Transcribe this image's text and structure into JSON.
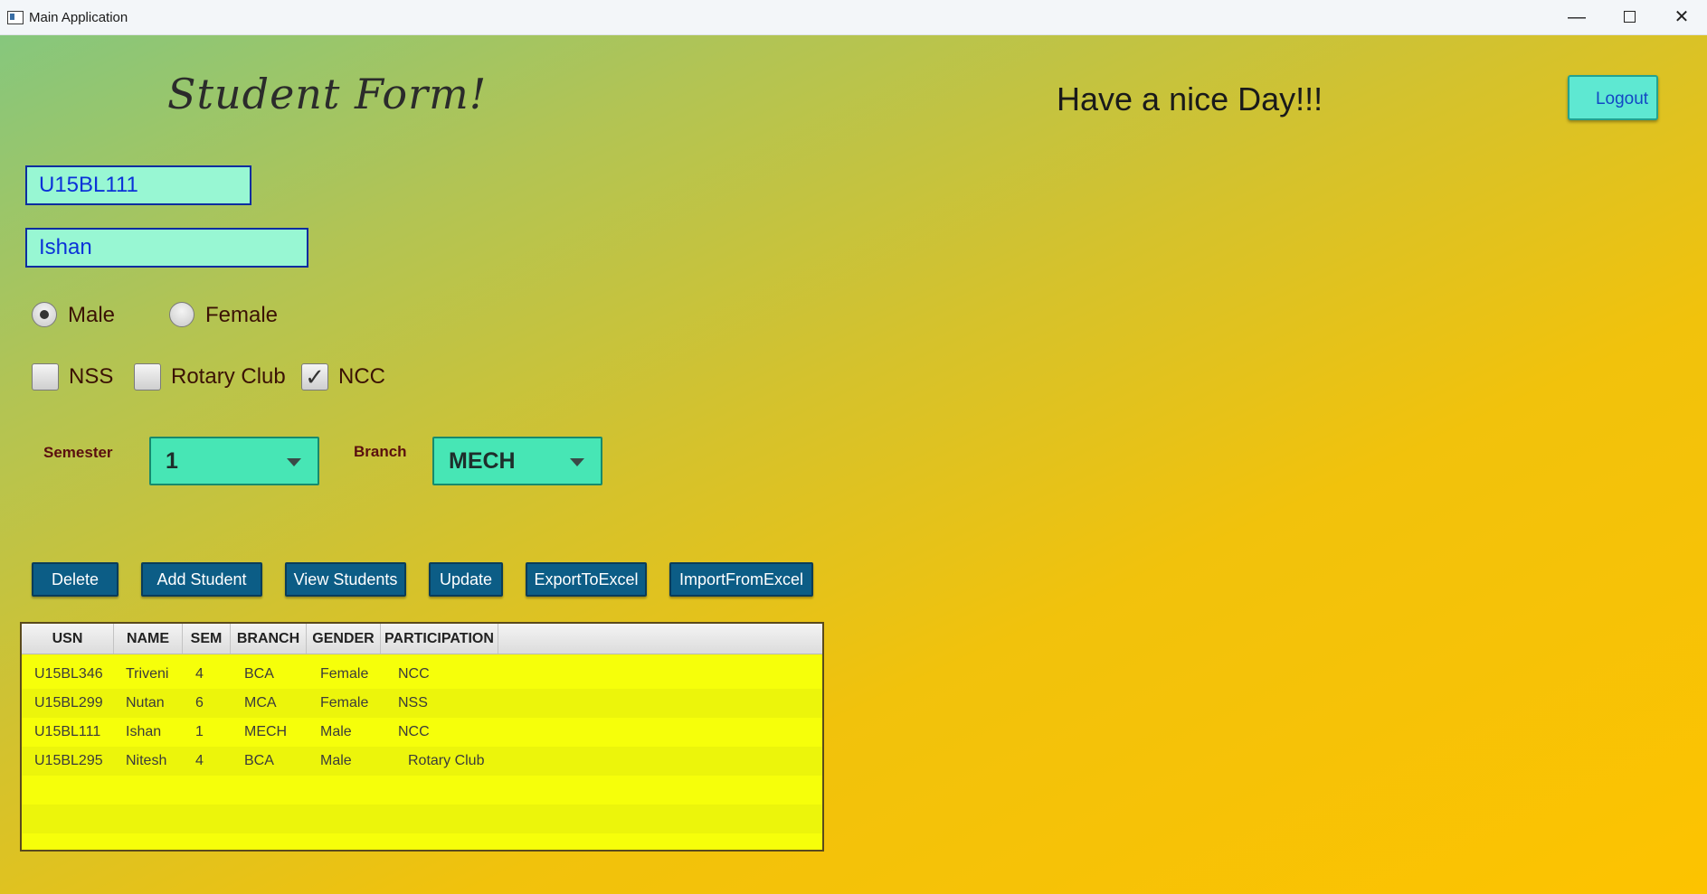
{
  "window": {
    "title": "Main Application",
    "minimize_glyph": "—",
    "close_glyph": "✕"
  },
  "header": {
    "heading": "Student Form!",
    "greeting": "Have a nice Day!!!",
    "logout_label": "Logout"
  },
  "form": {
    "usn_value": "U15BL111",
    "name_value": "Ishan",
    "gender": {
      "options": [
        "Male",
        "Female"
      ],
      "selected": "Male"
    },
    "participation": {
      "options": [
        {
          "label": "NSS",
          "checked": false
        },
        {
          "label": "Rotary Club",
          "checked": false
        },
        {
          "label": "NCC",
          "checked": true
        }
      ],
      "check_glyph": "✓"
    },
    "semester_label": "Semester",
    "semester_value": "1",
    "branch_label": "Branch",
    "branch_value": "MECH"
  },
  "actions": [
    "Delete",
    "Add Student",
    "View Students",
    "Update",
    "ExportToExcel",
    "ImportFromExcel"
  ],
  "table": {
    "columns": [
      "USN",
      "NAME",
      "SEM",
      "BRANCH",
      "GENDER",
      "PARTICIPATION"
    ],
    "rows": [
      [
        "U15BL346",
        "Triveni",
        "4",
        "BCA",
        "Female",
        "NCC"
      ],
      [
        "U15BL299",
        "Nutan",
        "6",
        "MCA",
        "Female",
        "NSS"
      ],
      [
        "U15BL111",
        "Ishan",
        "1",
        "MECH",
        "Male",
        "NCC"
      ],
      [
        "U15BL295",
        "Nitesh",
        "4",
        "BCA",
        "Male",
        "Rotary Club"
      ]
    ]
  },
  "colors": {
    "background_start": "#86c77d",
    "background_end": "#fdc300",
    "field_fill": "#98f7d3",
    "button_fill": "#0c5d86",
    "combo_fill": "#47e6b5",
    "table_fill": "#f6ff0a"
  }
}
